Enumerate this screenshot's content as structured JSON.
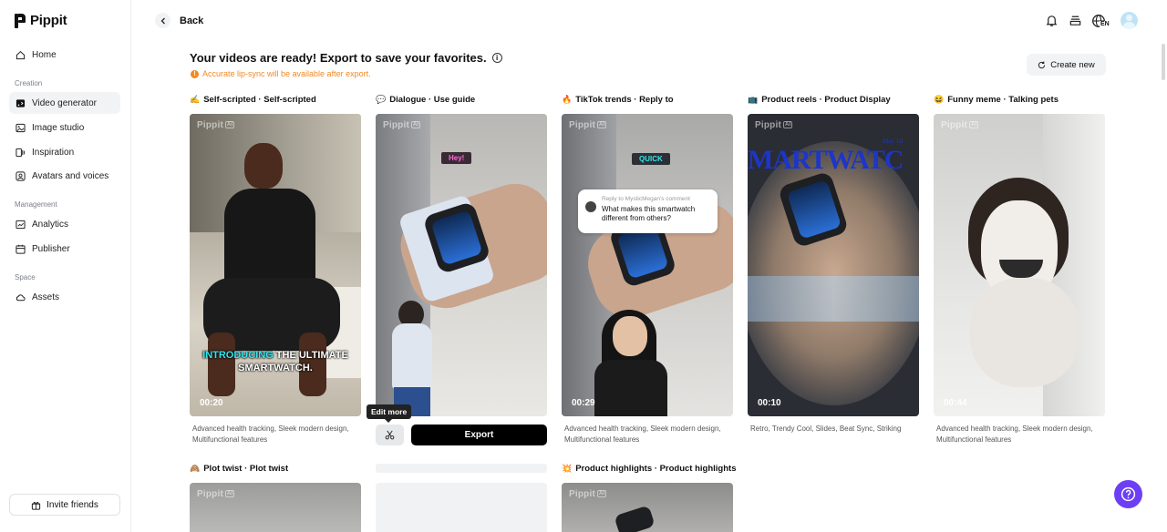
{
  "brand": {
    "name": "Pippit"
  },
  "sidebar": {
    "items": [
      {
        "label": "Home"
      },
      {
        "label": "Video generator"
      },
      {
        "label": "Image studio"
      },
      {
        "label": "Inspiration"
      },
      {
        "label": "Avatars and voices"
      },
      {
        "label": "Analytics"
      },
      {
        "label": "Publisher"
      },
      {
        "label": "Assets"
      }
    ],
    "sections": [
      "Creation",
      "Management",
      "Space"
    ],
    "invite_label": "Invite friends"
  },
  "header": {
    "back_label": "Back",
    "lang_badge": "EN"
  },
  "main": {
    "title": "Your videos are ready! Export to save your favorites.",
    "warning": "Accurate lip-sync will be available after export.",
    "create_new_label": "Create new",
    "watermark": "Pippit",
    "watermark_badge": "AI",
    "cards": [
      {
        "emoji": "✍️",
        "label": "Self-scripted · Self-scripted",
        "duration": "00:20",
        "description": "Advanced health tracking, Sleek modern design, Multifunctional features",
        "caption_hl": "INTRODUCING",
        "caption_rest": " THE ULTIMATE SMARTWATCH."
      },
      {
        "emoji": "💬",
        "label": "Dialogue · Use guide",
        "caption": "Hey!"
      },
      {
        "emoji": "🔥",
        "label": "TikTok trends · Reply to",
        "duration": "00:29",
        "description": "Advanced health tracking, Sleek modern design, Multifunctional features",
        "caption": "QUICK",
        "reply_to": "Reply to MysticMegan's comment",
        "reply_text": "What makes this smartwatch different from others?"
      },
      {
        "emoji": "📺",
        "label": "Product reels · Product Display",
        "duration": "00:10",
        "description": "Retro, Trendy Cool, Slides, Beat Sync, Striking",
        "overlay_text": "MARTWATC",
        "overlay_date": "May 1st"
      },
      {
        "emoji": "😆",
        "label": "Funny meme · Talking pets",
        "duration": "00:44",
        "description": "Advanced health tracking, Sleek modern design, Multifunctional features"
      },
      {
        "emoji": "🙈",
        "label": "Plot twist · Plot twist"
      },
      {
        "emoji": "",
        "label": ""
      },
      {
        "emoji": "💥",
        "label": "Product highlights · Product highlights"
      }
    ],
    "edit_more_label": "Edit more",
    "export_label": "Export"
  },
  "colors": {
    "accent": "#6c3ff5",
    "warning": "#f08a24",
    "caption_hl": "#2ee6f2"
  }
}
